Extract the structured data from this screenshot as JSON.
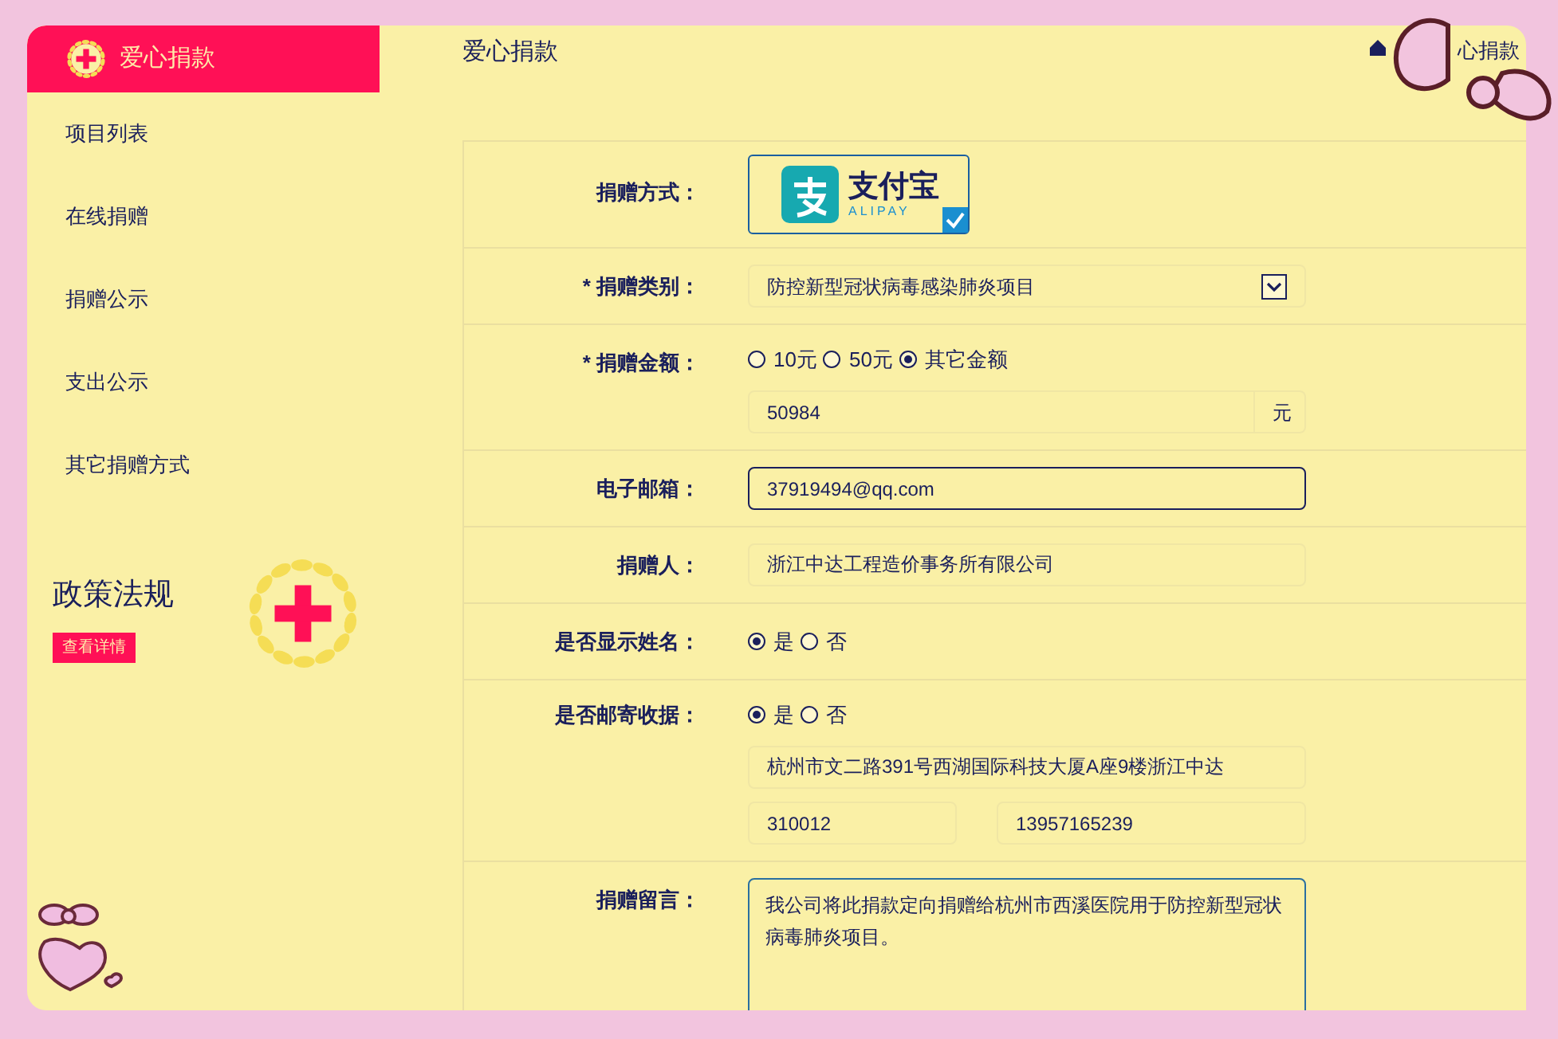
{
  "sidebar": {
    "brand": "爱心捐款",
    "items": [
      {
        "label": "项目列表"
      },
      {
        "label": "在线捐赠"
      },
      {
        "label": "捐赠公示"
      },
      {
        "label": "支出公示"
      },
      {
        "label": "其它捐赠方式"
      }
    ],
    "policy": {
      "title": "政策法规",
      "button": "查看详情"
    }
  },
  "header": {
    "title": "爱心捐款",
    "breadcrumb": "心捐款"
  },
  "form": {
    "rows": [
      {
        "kind": "payment",
        "label": "捐赠方式：",
        "logo_name": "支付宝",
        "logo_sub": "ALIPAY",
        "checked": true
      },
      {
        "kind": "select",
        "label": "* 捐赠类别：",
        "value": "防控新型冠状病毒感染肺炎项目"
      },
      {
        "kind": "amount",
        "label": "* 捐赠金额：",
        "options": [
          {
            "label": "10元",
            "selected": false
          },
          {
            "label": "50元",
            "selected": false
          },
          {
            "label": "其它金额",
            "selected": true
          }
        ],
        "value": "50984",
        "unit": "元"
      },
      {
        "kind": "input",
        "label": "电子邮箱：",
        "value": "37919494@qq.com",
        "focused": true
      },
      {
        "kind": "input",
        "label": "捐赠人：",
        "value": "浙江中达工程造价事务所有限公司",
        "focused": false
      },
      {
        "kind": "radio",
        "label": "是否显示姓名：",
        "options": [
          {
            "label": "是",
            "selected": true
          },
          {
            "label": "否",
            "selected": false
          }
        ]
      },
      {
        "kind": "mail",
        "label": "是否邮寄收据：",
        "options": [
          {
            "label": "是",
            "selected": true
          },
          {
            "label": "否",
            "selected": false
          }
        ],
        "address": "杭州市文二路391号西湖国际科技大厦A座9楼浙江中达",
        "postcode": "310012",
        "phone": "13957165239"
      },
      {
        "kind": "textarea",
        "label": "捐赠留言：",
        "value": "我公司将此捐款定向捐赠给杭州市西溪医院用于防控新型冠状病毒肺炎项目。",
        "focused": true
      }
    ]
  }
}
